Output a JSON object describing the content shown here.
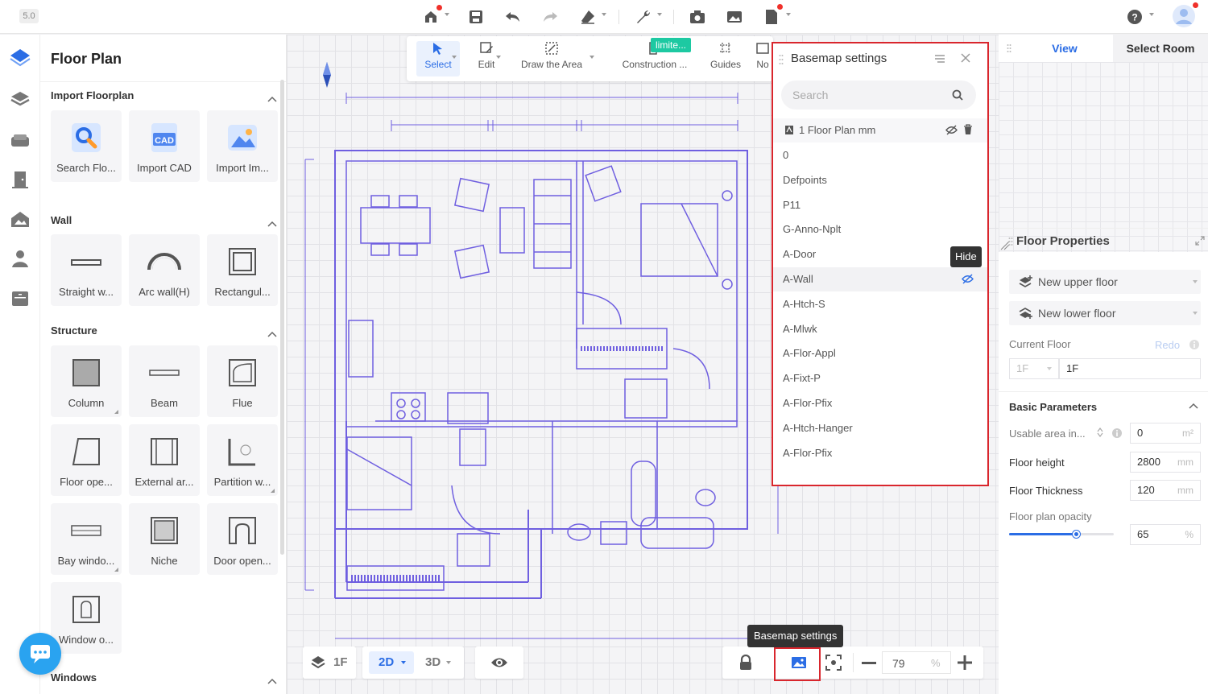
{
  "app": {
    "version": "5.0"
  },
  "floor_plan_panel": {
    "title": "Floor Plan",
    "sections": [
      {
        "title": "Import Floorplan",
        "items": [
          "Search Flo...",
          "Import CAD",
          "Import Im..."
        ]
      },
      {
        "title": "Wall",
        "items": [
          "Straight w...",
          "Arc wall(H)",
          "Rectangul..."
        ]
      },
      {
        "title": "Structure",
        "items": [
          "Column",
          "Beam",
          "Flue",
          "Floor ope...",
          "External ar...",
          "Partition w...",
          "Bay windo...",
          "Niche",
          "Door open...",
          "Window o..."
        ]
      },
      {
        "title": "Windows"
      }
    ],
    "cad_badge": "CAD"
  },
  "toolbar": {
    "items": [
      {
        "label": "Select"
      },
      {
        "label": "Edit"
      },
      {
        "label": "Draw the Area"
      },
      {
        "label": "Construction ..."
      },
      {
        "label": "Guides"
      },
      {
        "label": "No"
      }
    ],
    "badge": "limite..."
  },
  "basemap_panel": {
    "title": "Basemap settings",
    "search_placeholder": "Search",
    "file": "1 Floor Plan mm",
    "layers": [
      "0",
      "Defpoints",
      "P11",
      "G-Anno-Nplt",
      "A-Door",
      "A-Wall",
      "A-Htch-S",
      "A-Mlwk",
      "A-Flor-Appl",
      "A-Fixt-P",
      "A-Flor-Pfix",
      "A-Htch-Hanger",
      "A-Flor-Pfix"
    ],
    "highlighted_layer": "A-Wall",
    "tooltip": "Hide"
  },
  "right_panel": {
    "tabs": [
      "View",
      "Select Room"
    ],
    "active_tab": "View",
    "floor_properties_title": "Floor Properties",
    "new_upper_floor": "New upper floor",
    "new_lower_floor": "New lower floor",
    "current_floor_label": "Current Floor",
    "redo": "Redo",
    "floor_select": "1F",
    "floor_name": "1F",
    "basic_parameters_title": "Basic Parameters",
    "usable_area_label": "Usable area in...",
    "usable_area_value": "0",
    "usable_area_unit": "m²",
    "floor_height_label": "Floor height",
    "floor_height_value": "2800",
    "floor_height_unit": "mm",
    "floor_thickness_label": "Floor Thickness",
    "floor_thickness_value": "120",
    "floor_thickness_unit": "mm",
    "opacity_label": "Floor plan opacity",
    "opacity_value": "65",
    "opacity_unit": "%",
    "opacity_fraction": 0.65
  },
  "bottom_bar": {
    "floor": "1F",
    "mode_2d": "2D",
    "mode_3d": "3D",
    "zoom": "79",
    "zoom_unit": "%",
    "tooltip": "Basemap settings"
  },
  "colors": {
    "accent": "#2b6de5",
    "highlight_red": "#d9262d",
    "blueprint": "#6f5fe0",
    "teal_badge": "#1dc9a2"
  }
}
